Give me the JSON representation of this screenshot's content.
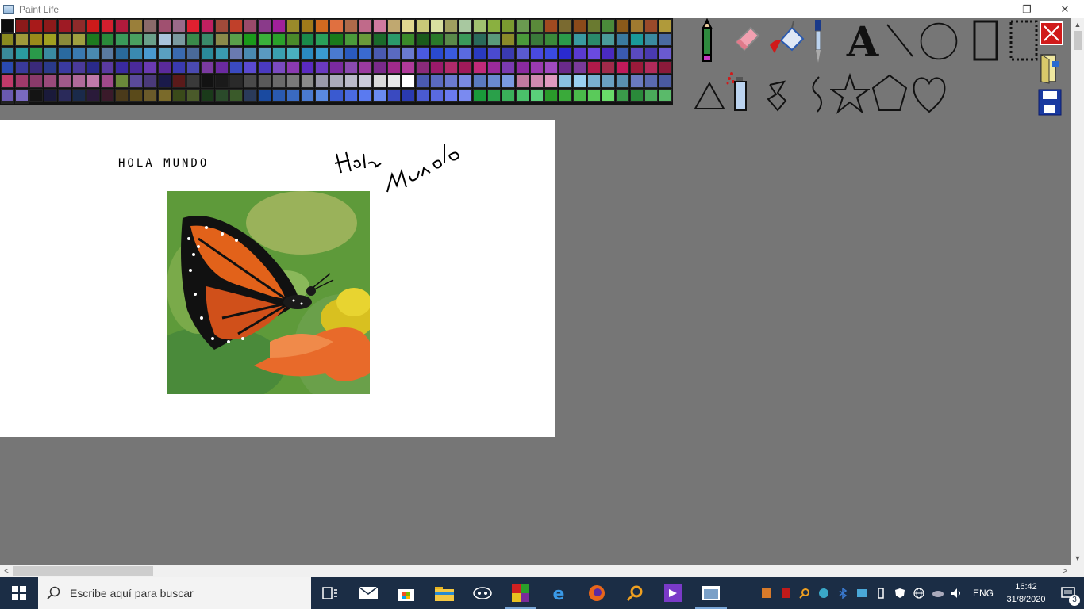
{
  "window": {
    "title": "Paint Life",
    "minimize_glyph": "—",
    "restore_glyph": "❐",
    "close_glyph": "✕"
  },
  "palette": {
    "colors": [
      "#0d0d0d",
      "#8c1a1a",
      "#a81a1a",
      "#8c1a1a",
      "#9e1a24",
      "#8f2a2a",
      "#cc1a1a",
      "#d41f2e",
      "#b01a3c",
      "#9a7f3a",
      "#8a6a6a",
      "#a05070",
      "#9a6a8a",
      "#e02030",
      "#c02060",
      "#a04a3a",
      "#c0402a",
      "#9a4a6a",
      "#8a3a8a",
      "#a0209a",
      "#9a8a2a",
      "#a07a1a",
      "#d06a20",
      "#e07040",
      "#b06a4a",
      "#c06a8a",
      "#d07aa0",
      "#c0a870",
      "#e0d890",
      "#c8c878",
      "#d8e0a0",
      "#a0a060",
      "#a8c8a0",
      "#a0c070",
      "#8ab040",
      "#7a9a30",
      "#6a9a50",
      "#5a8a3a",
      "#a04a20",
      "#7a6a30",
      "#8a4a1a",
      "#6a7a30",
      "#4a8a3a",
      "#8a5a1a",
      "#a07a30",
      "#9a4a2a",
      "#b09a3a",
      "#8a8a20",
      "#a09a3a",
      "#9a8a1a",
      "#a0a020",
      "#8a8a3a",
      "#a0a040",
      "#1e7a1e",
      "#2a8a3a",
      "#3a9a5a",
      "#4aa060",
      "#6aa08a",
      "#aac4dc",
      "#7a9aa0",
      "#3a8a4a",
      "#3a8a6a",
      "#8a8a4a",
      "#5aa04a",
      "#1a9a1a",
      "#3ab03a",
      "#2aa02a",
      "#4a8a2a",
      "#1a8a4a",
      "#2aa05a",
      "#1a7a1a",
      "#4a9a3a",
      "#6a9a3a",
      "#1a6a2a",
      "#2a9a6a",
      "#3a8a2a",
      "#1a5a1a",
      "#2a7a2a",
      "#5a8a4a",
      "#3a9a5a",
      "#2a6a5a",
      "#5a9a7a",
      "#8a8a2a",
      "#4a9a3a",
      "#3a7a3a",
      "#3a8a3a",
      "#2a9a4a",
      "#3a9aa0",
      "#2a8a6a",
      "#4a9a9a",
      "#3a7aa0",
      "#1a9a9a",
      "#3a8aa0",
      "#4a6aa0",
      "#3a8a9a",
      "#2a9aa0",
      "#2a9a4a",
      "#3a8aa0",
      "#2a6aa0",
      "#3a7ab0",
      "#4a8ab0",
      "#5a7aa0",
      "#2a6a9a",
      "#3a8ab0",
      "#4a9ad0",
      "#5aa0c0",
      "#3a6ab0",
      "#4a6a9a",
      "#2a8a9a",
      "#3a9ab0",
      "#6a7ab0",
      "#4a8ab0",
      "#5a9ac0",
      "#3aa0b0",
      "#4ab0c0",
      "#2a8ac0",
      "#3a9ad0",
      "#4a7ad0",
      "#2a5ac0",
      "#3a6ad0",
      "#4a5ab0",
      "#5a6ac0",
      "#6a7ad0",
      "#4a5ae0",
      "#2a4ad0",
      "#3a5ae0",
      "#5a6ae0",
      "#2a3ac0",
      "#4a4ad0",
      "#3a3ab0",
      "#5a5ad0",
      "#4a4ae0",
      "#3a4ae0",
      "#2a2ad0",
      "#5a3ad0",
      "#6a4ae0",
      "#4a2ac0",
      "#3a5ab0",
      "#5a4ac0",
      "#4a3ab0",
      "#6a5ad0",
      "#2a4ab0",
      "#3a3a9a",
      "#3a2a7a",
      "#2a3a8a",
      "#3a3aa0",
      "#4a3a9a",
      "#2a2a8a",
      "#5a3aa0",
      "#3a2aa0",
      "#4a2a9a",
      "#6a3ab0",
      "#5a2a9a",
      "#3a3ab0",
      "#4a4ab0",
      "#7a3aa0",
      "#6a2aa0",
      "#3a4ac0",
      "#5a4ad0",
      "#4a3ac0",
      "#7a4ac0",
      "#8a3ab0",
      "#5a2ac0",
      "#6a3ac0",
      "#7a2aa0",
      "#8a4ab0",
      "#9a3aa0",
      "#7a2a8a",
      "#a02a8a",
      "#b03a9a",
      "#8a2a7a",
      "#9a1a6a",
      "#b02a6a",
      "#a01a5a",
      "#c02a7a",
      "#9a2a9a",
      "#7a3ab0",
      "#8a2aa0",
      "#9a3ab0",
      "#a04ac0",
      "#6a2a8a",
      "#7a3a9a",
      "#b01a4a",
      "#a02a4a",
      "#c01a5a",
      "#9a1a3a",
      "#b02a5a",
      "#8a1a3a",
      "#c03a6a",
      "#a03a6a",
      "#8a3a6a",
      "#9a4a7a",
      "#a05a8a",
      "#b06a9a",
      "#c07aaa",
      "#a04a8a",
      "#6a8a3a",
      "#5a4a9a",
      "#4a3a7a",
      "#1a1a4a",
      "#5a1a1a",
      "#3a3a3a",
      "#121212",
      "#1a1a1a",
      "#2a2a2a",
      "#4a4a4a",
      "#5a5a5a",
      "#6a6a6a",
      "#7a7a7a",
      "#8a8a8a",
      "#9a9aaa",
      "#aaaaba",
      "#babaca",
      "#cacada",
      "#dadada",
      "#eaeaea",
      "#ffffff",
      "#4a5ab0",
      "#5a6ac0",
      "#6a7ad0",
      "#7a8ae0",
      "#5a7ac0",
      "#6a8ad0",
      "#7a9ae0",
      "#c07aa0",
      "#d08ab0",
      "#e09ac0",
      "#8ac0e0",
      "#9ad0f0",
      "#7ab0d0",
      "#6aa0c0",
      "#5a90b0",
      "#6a7ac0",
      "#5a6ab0",
      "#4a5aa0",
      "#6a5ab0",
      "#7a6ac0",
      "#141414",
      "#1a1a3a",
      "#2a2a5a",
      "#1a2a4a",
      "#2a1a3a",
      "#3a1a2a",
      "#4a3a1a",
      "#5a4a1a",
      "#6a5a2a",
      "#7a6a2a",
      "#3a4a1a",
      "#4a5a2a",
      "#1a3a1a",
      "#2a4a2a",
      "#3a5a2a",
      "#2a3a5a",
      "#1a4aa0",
      "#2a5ab0",
      "#3a6ac0",
      "#4a7ad0",
      "#5a8ae0",
      "#3a5ad0",
      "#4a6ae0",
      "#5a7af0",
      "#6a8af0",
      "#3a4ac0",
      "#2a3ab0",
      "#4a5ad0",
      "#5a6ae0",
      "#6a7af0",
      "#7a8af0",
      "#1a9a3a",
      "#2aa04a",
      "#3ab05a",
      "#4ac06a",
      "#5ad07a",
      "#2a9a2a",
      "#3aaa3a",
      "#4aba4a",
      "#5aca5a",
      "#6ada6a",
      "#3a9a4a",
      "#2a8a3a",
      "#4aaa5a",
      "#5aba6a",
      "#3a8a4a",
      "#4ab04a"
    ],
    "selected_index": 0
  },
  "tools": [
    {
      "name": "pencil-tool"
    },
    {
      "name": "eraser-tool"
    },
    {
      "name": "fill-bucket-tool"
    },
    {
      "name": "eyedropper-tool"
    },
    {
      "name": "text-tool"
    },
    {
      "name": "line-tool"
    },
    {
      "name": "circle-tool"
    },
    {
      "name": "rectangle-tool"
    },
    {
      "name": "select-rectangle-tool"
    },
    {
      "name": "close-tool"
    },
    {
      "name": "triangle-tool"
    },
    {
      "name": "spray-tool"
    },
    {
      "name": "freeform-polygon-tool"
    },
    {
      "name": "curve-tool"
    },
    {
      "name": "star-tool"
    },
    {
      "name": "pentagon-tool"
    },
    {
      "name": "heart-tool"
    },
    {
      "name": "open-file-tool"
    },
    {
      "name": "save-tool"
    }
  ],
  "canvas": {
    "text": "HOLA MUNDO",
    "image_subject": "monarch butterfly on flower"
  },
  "taskbar": {
    "search_placeholder": "Escribe aquí para buscar",
    "language": "ENG",
    "time": "16:42",
    "date": "31/8/2020",
    "notification_count": "3"
  },
  "scrollbars": {
    "up_arrow": "▲",
    "down_arrow": "▼",
    "left_arrow": "<",
    "right_arrow": ">"
  }
}
